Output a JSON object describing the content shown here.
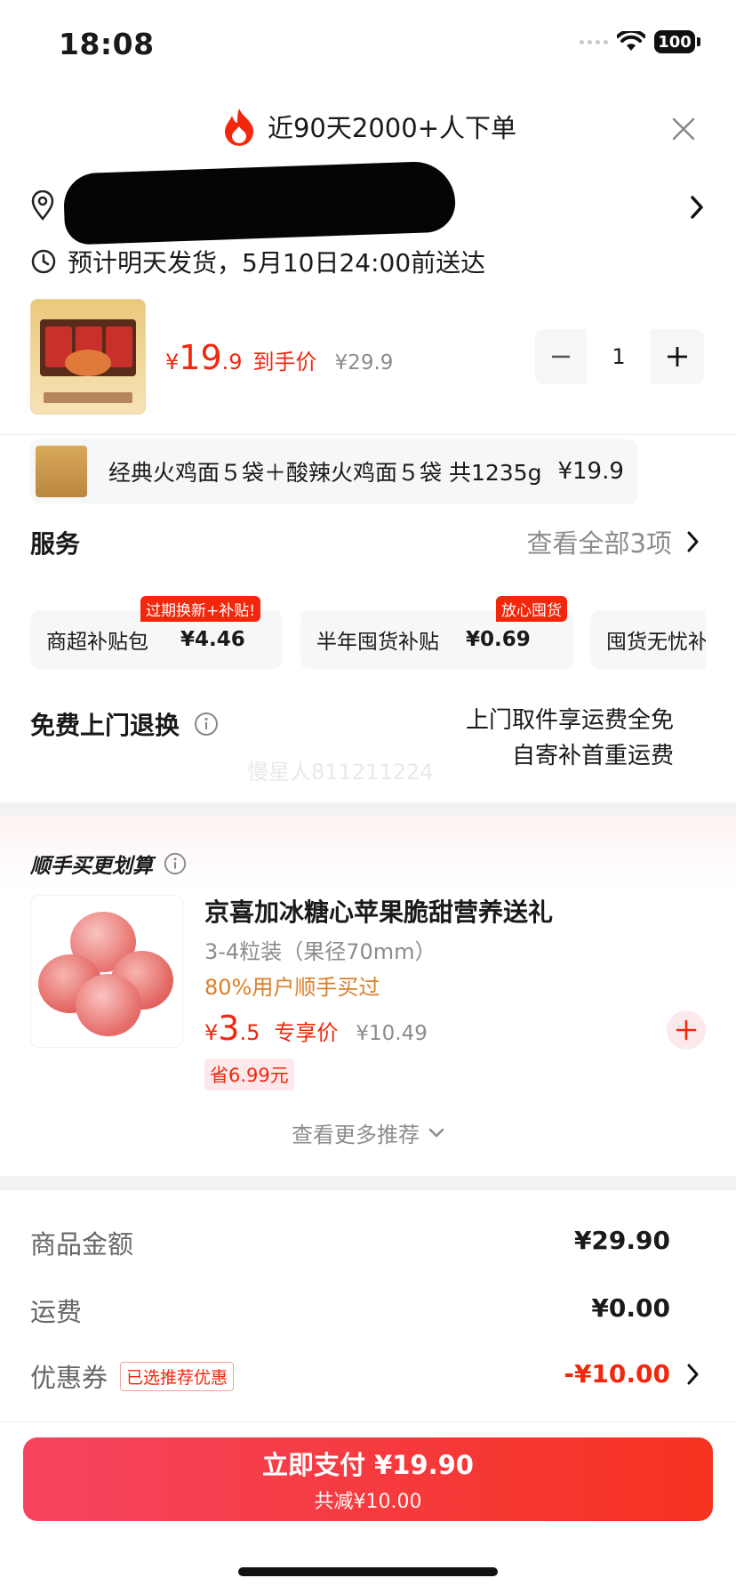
{
  "status_bar": {
    "time": "18:08",
    "battery": "100"
  },
  "banner": {
    "text": "近90天2000+人下单"
  },
  "shipping": {
    "text": "预计明天发货，5月10日24:00前送达"
  },
  "product": {
    "price_currency": "¥",
    "price_int": "19",
    "price_dec": ".9",
    "price_label": "到手价",
    "orig_price": "¥29.9",
    "quantity": "1",
    "variant_text": "经典火鸡面５袋＋酸辣火鸡面５袋 共1235g",
    "variant_price": "¥19.9"
  },
  "service": {
    "title": "服务",
    "view_all": "查看全部3项",
    "cards": [
      {
        "name": "商超补贴包",
        "price": "¥4.46",
        "tag": "过期换新+补贴!"
      },
      {
        "name": "半年囤货补贴",
        "price": "¥0.69",
        "tag": "放心囤货"
      },
      {
        "name": "囤货无忧补",
        "price": "",
        "tag": ""
      }
    ]
  },
  "return_service": {
    "title": "免费上门退换",
    "line1": "上门取件享运费全免",
    "line2": "自寄补首重运费",
    "watermark": "慢星人811211224"
  },
  "recommend": {
    "title": "顺手买更划算",
    "item": {
      "name": "京喜加冰糖心苹果脆甜营养送礼",
      "spec": "3-4粒装（果径70mm）",
      "social": "80%用户顺手买过",
      "price_currency": "¥",
      "price_int": "3",
      "price_dec": ".5",
      "price_label": "专享价",
      "orig_price": "¥10.49",
      "save": "省6.99元"
    },
    "more": "查看更多推荐"
  },
  "summary": {
    "goods_label": "商品金额",
    "goods_value": "¥29.90",
    "freight_label": "运费",
    "freight_value": "¥0.00",
    "coupon_label": "优惠券",
    "coupon_tag": "已选推荐优惠",
    "coupon_value": "-¥10.00"
  },
  "pay": {
    "label": "立即支付 ¥19.90",
    "sub": "共减¥10.00"
  },
  "colors": {
    "accent": "#f2270c",
    "pay_gradient_start": "#f64460",
    "pay_gradient_end": "#f6321f",
    "social_orange": "#d9802b"
  }
}
